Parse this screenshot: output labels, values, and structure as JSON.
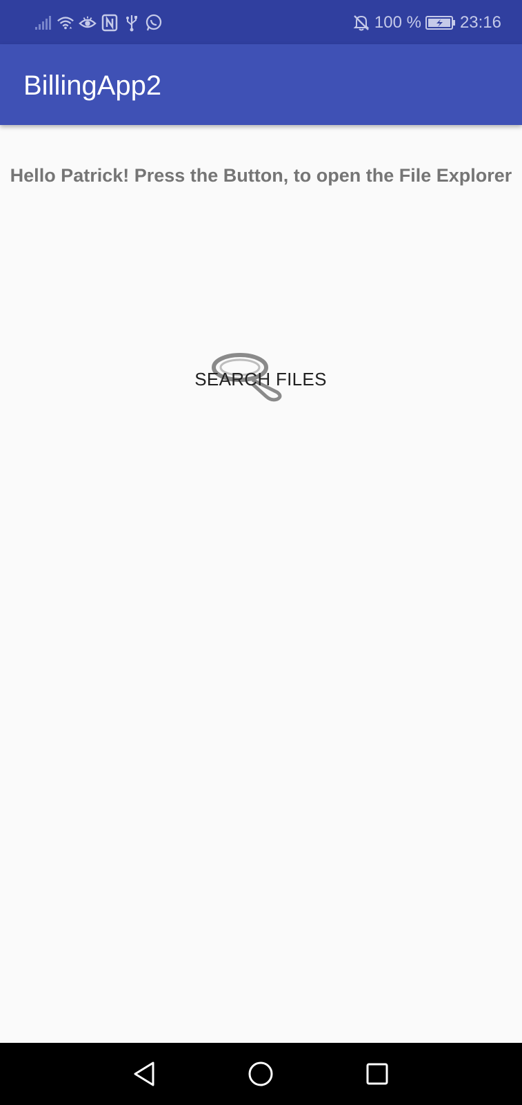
{
  "status_bar": {
    "left_icons": [
      "signal-icon",
      "wifi-icon",
      "eye-comfort-icon",
      "nfc-icon",
      "usb-icon",
      "whatsapp-icon"
    ],
    "mute_icon": "mute-icon",
    "battery_percent": "100 %",
    "battery_icon": "battery-charging-icon",
    "time": "23:16"
  },
  "app_bar": {
    "title": "BillingApp2",
    "color": "#3f51b5",
    "status_color": "#303f9f"
  },
  "main": {
    "greeting": "Hello Patrick! Press the Button, to open the File Explorer",
    "search_button": {
      "label": "SEARCH FILES",
      "icon": "magnifier-icon"
    }
  },
  "nav_bar": {
    "buttons": [
      "back-icon",
      "home-icon",
      "recents-icon"
    ]
  }
}
